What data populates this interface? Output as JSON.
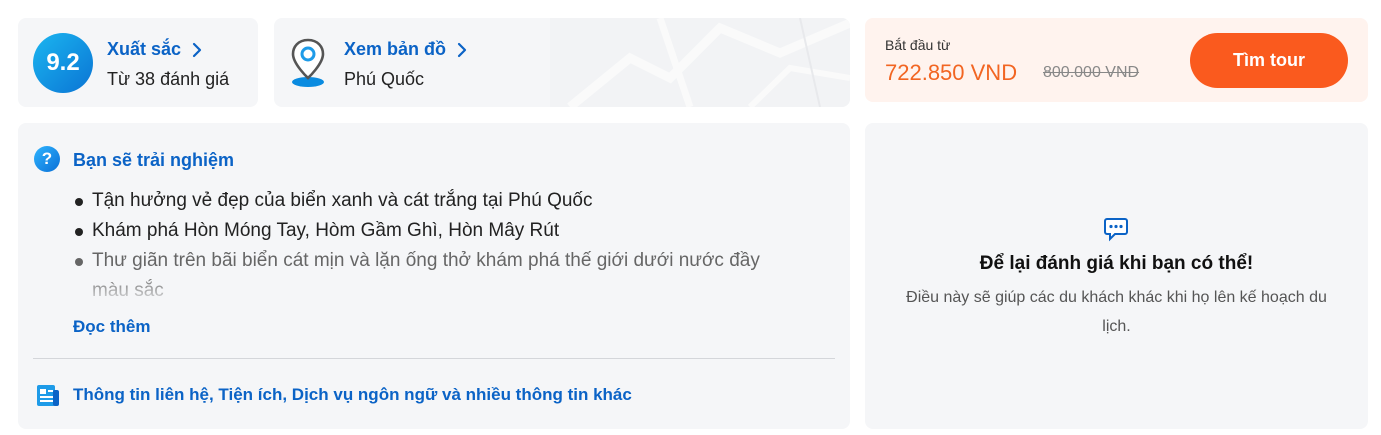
{
  "rating": {
    "score": "9.2",
    "label": "Xuất sắc",
    "reviews": "Từ 38 đánh giá"
  },
  "map": {
    "label": "Xem bản đồ",
    "location": "Phú Quốc"
  },
  "price": {
    "from_label": "Bắt đầu từ",
    "current": "722.850 VND",
    "original": "800.000 VND",
    "cta": "Tìm tour"
  },
  "experience": {
    "title": "Bạn sẽ trải nghiệm",
    "items": [
      "Tận hưởng vẻ đẹp của biển xanh và cát trắng tại Phú Quốc",
      "Khám phá Hòn Móng Tay, Hòm Gầm Ghì, Hòn Mây Rút",
      "Thư giãn trên bãi biển cát mịn và lặn ống thở khám phá thế giới dưới nước đầy màu sắc"
    ],
    "read_more": "Đọc thêm",
    "info_link": "Thông tin liên hệ, Tiện ích, Dịch vụ ngôn ngữ và nhiều thông tin khác"
  },
  "review": {
    "title": "Để lại đánh giá khi bạn có thể!",
    "description": "Điều này sẽ giúp các du khách khác khi họ lên kế hoạch du lịch."
  },
  "colors": {
    "accent_blue": "#0b63c6",
    "cta_orange": "#fa5a1e",
    "price_orange": "#f26522"
  },
  "icons": [
    "chevron-right-icon",
    "map-pin-icon",
    "question-icon",
    "info-document-icon",
    "chat-bubble-icon"
  ]
}
